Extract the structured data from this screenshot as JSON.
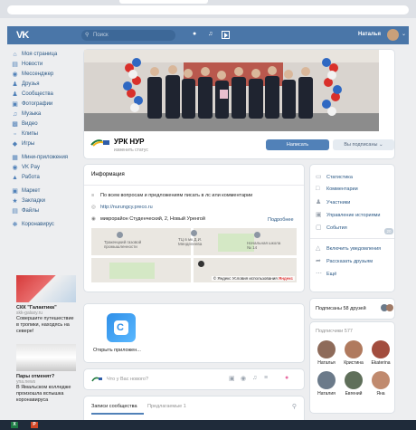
{
  "header": {
    "logo": "VK",
    "search_placeholder": "Поиск",
    "user_name": "Наталья"
  },
  "sidebar": {
    "items": [
      {
        "label": "Моя страница",
        "icon": "home-icon"
      },
      {
        "label": "Новости",
        "icon": "news-icon"
      },
      {
        "label": "Мессенджер",
        "icon": "messenger-icon"
      },
      {
        "label": "Друзья",
        "icon": "friends-icon"
      },
      {
        "label": "Сообщества",
        "icon": "communities-icon"
      },
      {
        "label": "Фотографии",
        "icon": "photo-icon"
      },
      {
        "label": "Музыка",
        "icon": "music-icon"
      },
      {
        "label": "Видео",
        "icon": "video-icon"
      },
      {
        "label": "Клипы",
        "icon": "clips-icon"
      },
      {
        "label": "Игры",
        "icon": "games-icon"
      },
      {
        "label": "Мини-приложения",
        "icon": "mini-apps-icon"
      },
      {
        "label": "VK Pay",
        "icon": "vkpay-icon"
      },
      {
        "label": "Работа",
        "icon": "work-icon"
      },
      {
        "label": "Маркет",
        "icon": "market-icon"
      },
      {
        "label": "Закладки",
        "icon": "bookmarks-icon"
      },
      {
        "label": "Файлы",
        "icon": "files-icon"
      },
      {
        "label": "Коронавирус",
        "icon": "coronavirus-icon"
      }
    ]
  },
  "ads": [
    {
      "title": "СКК \"Галактика\"",
      "source": "skk-galaxy.ru",
      "text": "Совершите путешествие в тропики, находясь на севере!"
    },
    {
      "title": "Пары отменят?",
      "source": "yna.news",
      "text": "В Ямальском колледже произошла вспышка коронавируса"
    }
  ],
  "profile": {
    "name": "УРК НУР",
    "status": "изменить статус",
    "write_button": "Написать",
    "subscribed_button": "Вы подписаны ⌄"
  },
  "info": {
    "title": "Информация",
    "description": "По всем вопросам и предложениям писать в лс или комментарии",
    "website": "http://nurungcy.preco.ru",
    "address": "микрорайон Студенческий, 2, Новый Уренгой",
    "details_link": "Подробнее",
    "map": {
      "label_industrial": "Тракенцкий газовой промышленности",
      "label_school": "Начальная школа № 14",
      "label_mfc": "ТЦ в мк Д.И. Менделеева",
      "footer": "© Яндекс Условия использования",
      "brand": "Яндекс"
    }
  },
  "right_menu": {
    "items": [
      {
        "label": "Статистика",
        "icon": "statistics-icon"
      },
      {
        "label": "Комментарии",
        "icon": "comments-icon"
      },
      {
        "label": "Участники",
        "icon": "members-icon"
      },
      {
        "label": "Управление историями",
        "icon": "stories-icon"
      },
      {
        "label": "События",
        "icon": "events-icon",
        "badge": "20"
      },
      {
        "label": "Включить уведомления",
        "icon": "bell-icon"
      },
      {
        "label": "Рассказать друзьям",
        "icon": "share-icon"
      },
      {
        "label": "Ещё",
        "icon": "more-icon"
      }
    ]
  },
  "friends": {
    "label": "Подписаны 58 друзей"
  },
  "subscribers": {
    "label": "Подписчики",
    "count": "577",
    "people": [
      {
        "name": "Наталья",
        "color": "#8e6b5a"
      },
      {
        "name": "Кристина",
        "color": "#b07a5e"
      },
      {
        "name": "Ekaterina",
        "color": "#a24d3e"
      },
      {
        "name": "Наталия",
        "color": "#6b7a8a"
      },
      {
        "name": "Евгений",
        "color": "#5f6f5a"
      },
      {
        "name": "Яна",
        "color": "#c08a6e"
      }
    ]
  },
  "app": {
    "label": "Открыть приложен..."
  },
  "post": {
    "placeholder": "Что у Вас нового?"
  },
  "wall": {
    "tab_records": "Записи сообщества",
    "tab_suggested": "Предлагаемые",
    "suggested_count": "1"
  },
  "taskbar": {
    "app1": "X",
    "app2": "P"
  }
}
